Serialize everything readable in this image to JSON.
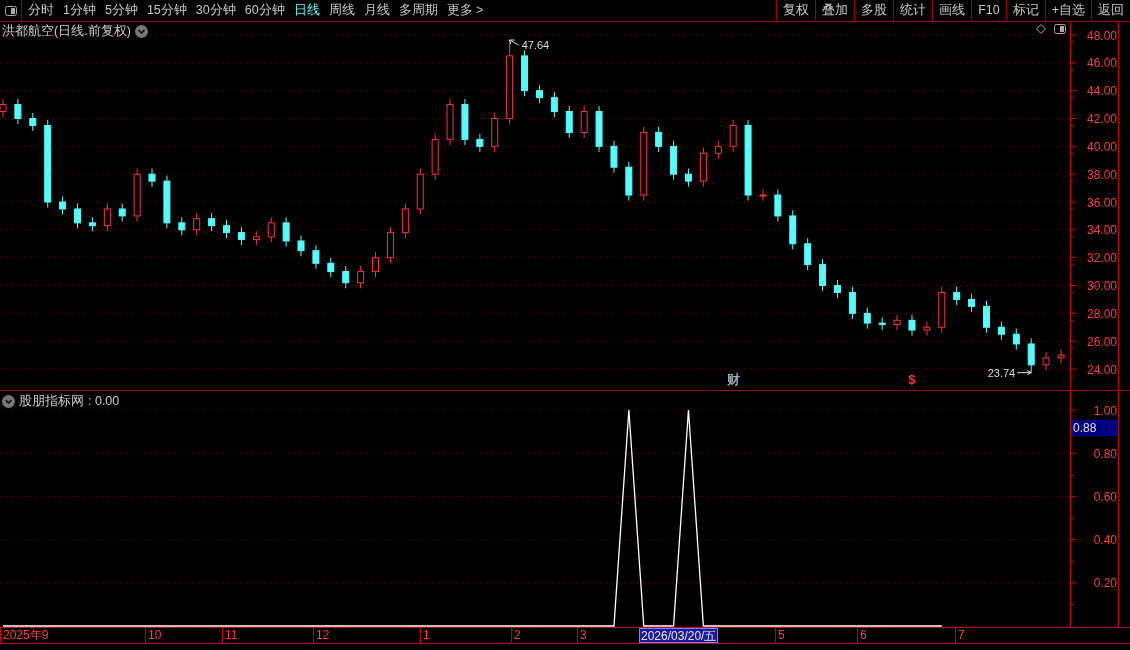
{
  "toolbar": {
    "periods": [
      {
        "label": "分时",
        "selected": false
      },
      {
        "label": "1分钟",
        "selected": false
      },
      {
        "label": "5分钟",
        "selected": false
      },
      {
        "label": "15分钟",
        "selected": false
      },
      {
        "label": "30分钟",
        "selected": false
      },
      {
        "label": "60分钟",
        "selected": false
      },
      {
        "label": "日线",
        "selected": true
      },
      {
        "label": "周线",
        "selected": false
      },
      {
        "label": "月线",
        "selected": false
      },
      {
        "label": "多周期",
        "selected": false
      },
      {
        "label": "更多 >",
        "selected": false
      }
    ],
    "actions": [
      "复权",
      "叠加",
      "多股",
      "统计",
      "画线",
      "F10",
      "标记",
      "+自选",
      "返回"
    ]
  },
  "price_panel": {
    "title": "洪都航空(日线.前复权)",
    "chart_data": {
      "type": "candlestick",
      "grid": true,
      "ylim": [
        24,
        48
      ],
      "yticks": [
        {
          "value": 24,
          "label": "24.00"
        },
        {
          "value": 26,
          "label": "26.00"
        },
        {
          "value": 28,
          "label": "28.00"
        },
        {
          "value": 30,
          "label": "30.00"
        },
        {
          "value": 32,
          "label": "32.00"
        },
        {
          "value": 34,
          "label": "34.00"
        },
        {
          "value": 36,
          "label": "36.00"
        },
        {
          "value": 38,
          "label": "38.00"
        },
        {
          "value": 40,
          "label": "40.00"
        },
        {
          "value": 42,
          "label": "42.00"
        },
        {
          "value": 44,
          "label": "44.00"
        },
        {
          "value": 46,
          "label": "46.00"
        },
        {
          "value": 48,
          "label": "48.00"
        }
      ],
      "ohlc": [
        [
          42.5,
          43.4,
          42.1,
          43
        ],
        [
          43,
          43.4,
          41.6,
          42
        ],
        [
          42,
          42.4,
          41.1,
          41.5
        ],
        [
          41.5,
          41.9,
          35.6,
          36
        ],
        [
          36,
          36.4,
          35.1,
          35.5
        ],
        [
          35.5,
          35.9,
          34.1,
          34.5
        ],
        [
          34.5,
          34.9,
          33.9,
          34.3
        ],
        [
          34.3,
          35.9,
          33.9,
          35.5
        ],
        [
          35.5,
          35.9,
          34.6,
          35
        ],
        [
          35,
          38.4,
          34.6,
          38
        ],
        [
          38,
          38.4,
          37.1,
          37.5
        ],
        [
          37.5,
          37.9,
          34.1,
          34.5
        ],
        [
          34.5,
          34.9,
          33.6,
          34
        ],
        [
          34,
          35.2,
          33.6,
          34.8
        ],
        [
          34.8,
          35.2,
          33.9,
          34.3
        ],
        [
          34.3,
          34.7,
          33.4,
          33.8
        ],
        [
          33.8,
          34.2,
          32.9,
          33.3
        ],
        [
          33.3,
          33.9,
          32.9,
          33.5
        ],
        [
          33.5,
          34.9,
          33.1,
          34.5
        ],
        [
          34.5,
          34.9,
          32.8,
          33.2
        ],
        [
          33.2,
          33.6,
          32.1,
          32.5
        ],
        [
          32.5,
          32.9,
          31.2,
          31.6
        ],
        [
          31.6,
          32,
          30.6,
          31
        ],
        [
          31,
          31.4,
          29.8,
          30.2
        ],
        [
          30.2,
          31.4,
          29.8,
          31
        ],
        [
          31,
          32.4,
          30.6,
          32
        ],
        [
          32,
          34.2,
          31.6,
          33.8
        ],
        [
          33.8,
          35.9,
          33.4,
          35.5
        ],
        [
          35.5,
          38.4,
          35.1,
          38
        ],
        [
          38,
          40.9,
          37.6,
          40.5
        ],
        [
          40.5,
          43.4,
          40.1,
          43
        ],
        [
          43,
          43.4,
          40.1,
          40.5
        ],
        [
          40.5,
          40.9,
          39.6,
          40
        ],
        [
          40,
          42.4,
          39.6,
          42
        ],
        [
          42,
          47.64,
          41.6,
          46.5
        ],
        [
          46.5,
          46.9,
          43.6,
          44
        ],
        [
          44,
          44.4,
          43.1,
          43.5
        ],
        [
          43.5,
          43.9,
          42.1,
          42.5
        ],
        [
          42.5,
          42.9,
          40.6,
          41
        ],
        [
          41,
          42.9,
          40.6,
          42.5
        ],
        [
          42.5,
          42.9,
          39.6,
          40
        ],
        [
          40,
          40.4,
          38.1,
          38.5
        ],
        [
          38.5,
          38.9,
          36.1,
          36.5
        ],
        [
          36.5,
          41.4,
          36.1,
          41
        ],
        [
          41,
          41.4,
          39.6,
          40
        ],
        [
          40,
          40.4,
          37.6,
          38
        ],
        [
          38,
          38.4,
          37.1,
          37.5
        ],
        [
          37.5,
          39.9,
          37.1,
          39.5
        ],
        [
          39.5,
          40.4,
          39.1,
          40
        ],
        [
          40,
          41.9,
          39.6,
          41.5
        ],
        [
          41.5,
          41.9,
          36.1,
          36.5
        ],
        [
          36.5,
          36.9,
          36.1,
          36.5
        ],
        [
          36.5,
          36.9,
          34.6,
          35
        ],
        [
          35,
          35.4,
          32.6,
          33
        ],
        [
          33,
          33.4,
          31.1,
          31.5
        ],
        [
          31.5,
          31.9,
          29.6,
          30
        ],
        [
          30,
          30.4,
          29.1,
          29.5
        ],
        [
          29.5,
          29.9,
          27.6,
          28
        ],
        [
          28,
          28.4,
          26.9,
          27.3
        ],
        [
          27.3,
          27.7,
          26.8,
          27.2
        ],
        [
          27.2,
          27.9,
          26.8,
          27.5
        ],
        [
          27.5,
          27.9,
          26.4,
          26.8
        ],
        [
          26.8,
          27.4,
          26.4,
          27
        ],
        [
          27,
          29.9,
          26.6,
          29.5
        ],
        [
          29.5,
          29.9,
          28.6,
          29
        ],
        [
          29,
          29.4,
          28.1,
          28.5
        ],
        [
          28.5,
          28.9,
          26.6,
          27
        ],
        [
          27,
          27.4,
          26.1,
          26.5
        ],
        [
          26.5,
          26.9,
          25.4,
          25.8
        ],
        [
          25.8,
          26.2,
          23.74,
          24.3
        ],
        [
          24.3,
          25.2,
          23.9,
          24.8
        ],
        [
          24.8,
          25.4,
          24.4,
          25
        ]
      ],
      "annotations": [
        "47.64",
        "23.74"
      ]
    },
    "markers": [
      {
        "label": "财",
        "color": "#99aabb"
      },
      {
        "label": "$",
        "color": "#ff3232"
      }
    ]
  },
  "indicator_panel": {
    "value_text": ": 0.00",
    "cursor_value": "0.88",
    "chart_data": {
      "type": "line",
      "grid": true,
      "ylim": [
        0,
        1
      ],
      "yticks": [
        {
          "value": 0.2,
          "label": "0.20"
        },
        {
          "value": 0.4,
          "label": "0.40"
        },
        {
          "value": 0.6,
          "label": "0.60"
        },
        {
          "value": 0.8,
          "label": "0.80"
        },
        {
          "value": 1.0,
          "label": "1.00"
        }
      ],
      "series": [
        {
          "name": "股朋指标网",
          "color": "#ffffff",
          "values": [
            0,
            0,
            0,
            0,
            0,
            0,
            0,
            0,
            0,
            0,
            0,
            0,
            0,
            0,
            0,
            0,
            0,
            0,
            0,
            0,
            0,
            0,
            0,
            0,
            0,
            0,
            0,
            0,
            0,
            0,
            0,
            0,
            0,
            0,
            0,
            0,
            0,
            0,
            0,
            0,
            0,
            0,
            1,
            0,
            0,
            0,
            1,
            0,
            0,
            0,
            0,
            0,
            0,
            0,
            0,
            0,
            0,
            0,
            0,
            0,
            0,
            0,
            0,
            0
          ]
        }
      ]
    }
  },
  "x_axis": [
    {
      "label": "2025年9",
      "selected": false
    },
    {
      "label": "10",
      "selected": false
    },
    {
      "label": "11",
      "selected": false
    },
    {
      "label": "12",
      "selected": false
    },
    {
      "label": "1",
      "selected": false
    },
    {
      "label": "2",
      "selected": false
    },
    {
      "label": "3",
      "selected": false
    },
    {
      "label": "2026/03/20/五",
      "selected": true
    },
    {
      "label": "5",
      "selected": false
    },
    {
      "label": "6",
      "selected": false
    },
    {
      "label": "7",
      "selected": false
    }
  ]
}
